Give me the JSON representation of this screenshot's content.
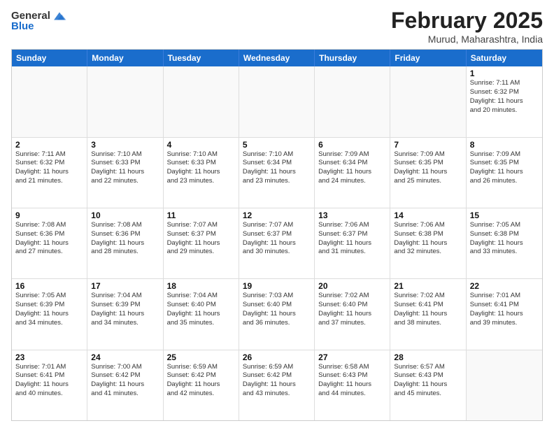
{
  "logo": {
    "general": "General",
    "blue": "Blue"
  },
  "header": {
    "month": "February 2025",
    "location": "Murud, Maharashtra, India"
  },
  "weekdays": [
    "Sunday",
    "Monday",
    "Tuesday",
    "Wednesday",
    "Thursday",
    "Friday",
    "Saturday"
  ],
  "rows": [
    [
      {
        "day": "",
        "text": "",
        "empty": true
      },
      {
        "day": "",
        "text": "",
        "empty": true
      },
      {
        "day": "",
        "text": "",
        "empty": true
      },
      {
        "day": "",
        "text": "",
        "empty": true
      },
      {
        "day": "",
        "text": "",
        "empty": true
      },
      {
        "day": "",
        "text": "",
        "empty": true
      },
      {
        "day": "1",
        "text": "Sunrise: 7:11 AM\nSunset: 6:32 PM\nDaylight: 11 hours\nand 20 minutes."
      }
    ],
    [
      {
        "day": "2",
        "text": "Sunrise: 7:11 AM\nSunset: 6:32 PM\nDaylight: 11 hours\nand 21 minutes."
      },
      {
        "day": "3",
        "text": "Sunrise: 7:10 AM\nSunset: 6:33 PM\nDaylight: 11 hours\nand 22 minutes."
      },
      {
        "day": "4",
        "text": "Sunrise: 7:10 AM\nSunset: 6:33 PM\nDaylight: 11 hours\nand 23 minutes."
      },
      {
        "day": "5",
        "text": "Sunrise: 7:10 AM\nSunset: 6:34 PM\nDaylight: 11 hours\nand 23 minutes."
      },
      {
        "day": "6",
        "text": "Sunrise: 7:09 AM\nSunset: 6:34 PM\nDaylight: 11 hours\nand 24 minutes."
      },
      {
        "day": "7",
        "text": "Sunrise: 7:09 AM\nSunset: 6:35 PM\nDaylight: 11 hours\nand 25 minutes."
      },
      {
        "day": "8",
        "text": "Sunrise: 7:09 AM\nSunset: 6:35 PM\nDaylight: 11 hours\nand 26 minutes."
      }
    ],
    [
      {
        "day": "9",
        "text": "Sunrise: 7:08 AM\nSunset: 6:36 PM\nDaylight: 11 hours\nand 27 minutes."
      },
      {
        "day": "10",
        "text": "Sunrise: 7:08 AM\nSunset: 6:36 PM\nDaylight: 11 hours\nand 28 minutes."
      },
      {
        "day": "11",
        "text": "Sunrise: 7:07 AM\nSunset: 6:37 PM\nDaylight: 11 hours\nand 29 minutes."
      },
      {
        "day": "12",
        "text": "Sunrise: 7:07 AM\nSunset: 6:37 PM\nDaylight: 11 hours\nand 30 minutes."
      },
      {
        "day": "13",
        "text": "Sunrise: 7:06 AM\nSunset: 6:37 PM\nDaylight: 11 hours\nand 31 minutes."
      },
      {
        "day": "14",
        "text": "Sunrise: 7:06 AM\nSunset: 6:38 PM\nDaylight: 11 hours\nand 32 minutes."
      },
      {
        "day": "15",
        "text": "Sunrise: 7:05 AM\nSunset: 6:38 PM\nDaylight: 11 hours\nand 33 minutes."
      }
    ],
    [
      {
        "day": "16",
        "text": "Sunrise: 7:05 AM\nSunset: 6:39 PM\nDaylight: 11 hours\nand 34 minutes."
      },
      {
        "day": "17",
        "text": "Sunrise: 7:04 AM\nSunset: 6:39 PM\nDaylight: 11 hours\nand 34 minutes."
      },
      {
        "day": "18",
        "text": "Sunrise: 7:04 AM\nSunset: 6:40 PM\nDaylight: 11 hours\nand 35 minutes."
      },
      {
        "day": "19",
        "text": "Sunrise: 7:03 AM\nSunset: 6:40 PM\nDaylight: 11 hours\nand 36 minutes."
      },
      {
        "day": "20",
        "text": "Sunrise: 7:02 AM\nSunset: 6:40 PM\nDaylight: 11 hours\nand 37 minutes."
      },
      {
        "day": "21",
        "text": "Sunrise: 7:02 AM\nSunset: 6:41 PM\nDaylight: 11 hours\nand 38 minutes."
      },
      {
        "day": "22",
        "text": "Sunrise: 7:01 AM\nSunset: 6:41 PM\nDaylight: 11 hours\nand 39 minutes."
      }
    ],
    [
      {
        "day": "23",
        "text": "Sunrise: 7:01 AM\nSunset: 6:41 PM\nDaylight: 11 hours\nand 40 minutes."
      },
      {
        "day": "24",
        "text": "Sunrise: 7:00 AM\nSunset: 6:42 PM\nDaylight: 11 hours\nand 41 minutes."
      },
      {
        "day": "25",
        "text": "Sunrise: 6:59 AM\nSunset: 6:42 PM\nDaylight: 11 hours\nand 42 minutes."
      },
      {
        "day": "26",
        "text": "Sunrise: 6:59 AM\nSunset: 6:42 PM\nDaylight: 11 hours\nand 43 minutes."
      },
      {
        "day": "27",
        "text": "Sunrise: 6:58 AM\nSunset: 6:43 PM\nDaylight: 11 hours\nand 44 minutes."
      },
      {
        "day": "28",
        "text": "Sunrise: 6:57 AM\nSunset: 6:43 PM\nDaylight: 11 hours\nand 45 minutes."
      },
      {
        "day": "",
        "text": "",
        "empty": true
      }
    ]
  ]
}
